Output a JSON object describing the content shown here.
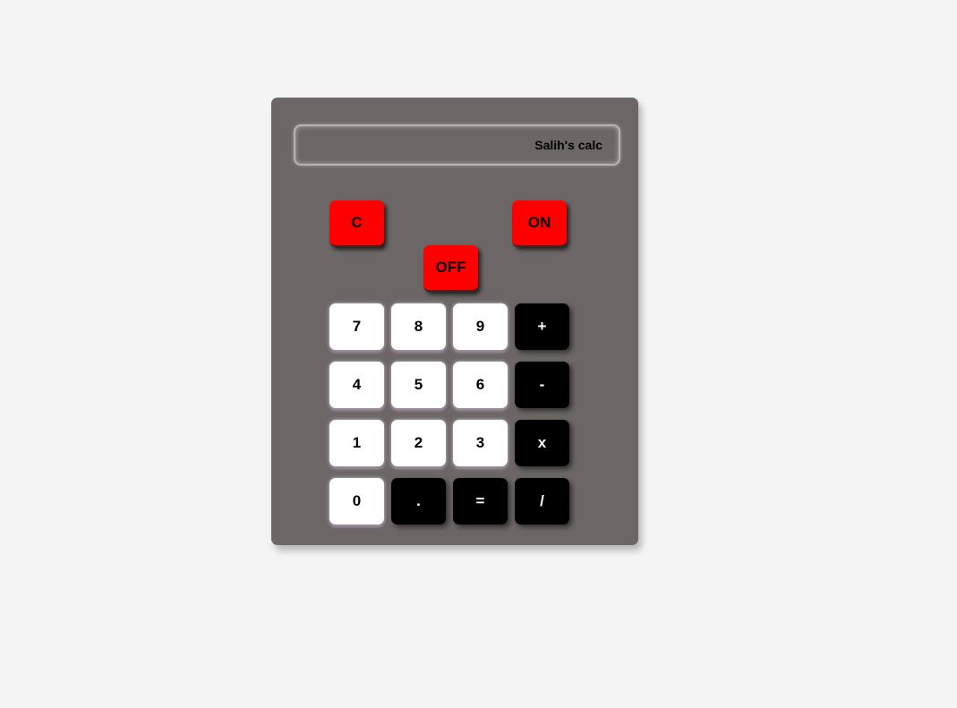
{
  "display": {
    "text": "Salih's calc"
  },
  "controls": {
    "clear_label": "C",
    "on_label": "ON",
    "off_label": "OFF"
  },
  "keys": {
    "seven": "7",
    "eight": "8",
    "nine": "9",
    "plus": "+",
    "four": "4",
    "five": "5",
    "six": "6",
    "minus": "-",
    "one": "1",
    "two": "2",
    "three": "3",
    "multiply": "x",
    "zero": "0",
    "decimal": ".",
    "equals": "=",
    "divide": "/"
  },
  "colors": {
    "body": "#6c6766",
    "control_key": "#ff0000",
    "digit_key": "#ffffff",
    "operator_key": "#000000"
  }
}
